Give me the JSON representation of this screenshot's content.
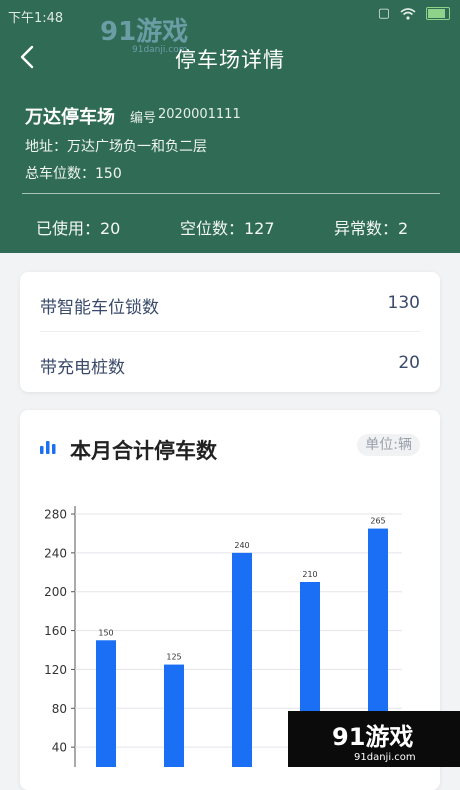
{
  "status_bar": {
    "time": "下午1:48"
  },
  "header": {
    "title": "停车场详情",
    "lot_name": "万达停车场",
    "code_label": "编号",
    "code": "2020001111",
    "address": "地址：万达广场负一和负二层",
    "total_spaces": "总车位数：150",
    "stats": {
      "used": "已使用：20",
      "free": "空位数：127",
      "abnormal": "异常数：2"
    }
  },
  "info": [
    {
      "label": "带智能车位锁数",
      "value": "130"
    },
    {
      "label": "带充电桩数",
      "value": "20"
    }
  ],
  "chart_header": {
    "title": "本月合计停车数",
    "unit": "单位:辆"
  },
  "chart_data": {
    "type": "bar",
    "values": [
      150,
      125,
      240,
      210,
      265
    ],
    "data_labels": [
      "150",
      "125",
      "240",
      "210",
      "265"
    ],
    "y_ticks": [
      40,
      80,
      120,
      160,
      200,
      240,
      280
    ],
    "ylim": [
      0,
      280
    ],
    "grid": true,
    "bar_color": "#1a6ff5"
  },
  "watermark": {
    "brand": "91游戏",
    "site": "91danji.com"
  },
  "colors": {
    "header_bg": "#2f6b55",
    "accent": "#1a6ff5",
    "label": "#3a4a6b"
  },
  "icons": {
    "back": "chevron-left-icon",
    "wifi": "wifi-icon",
    "battery": "battery-icon",
    "chart": "bar-chart-icon"
  }
}
